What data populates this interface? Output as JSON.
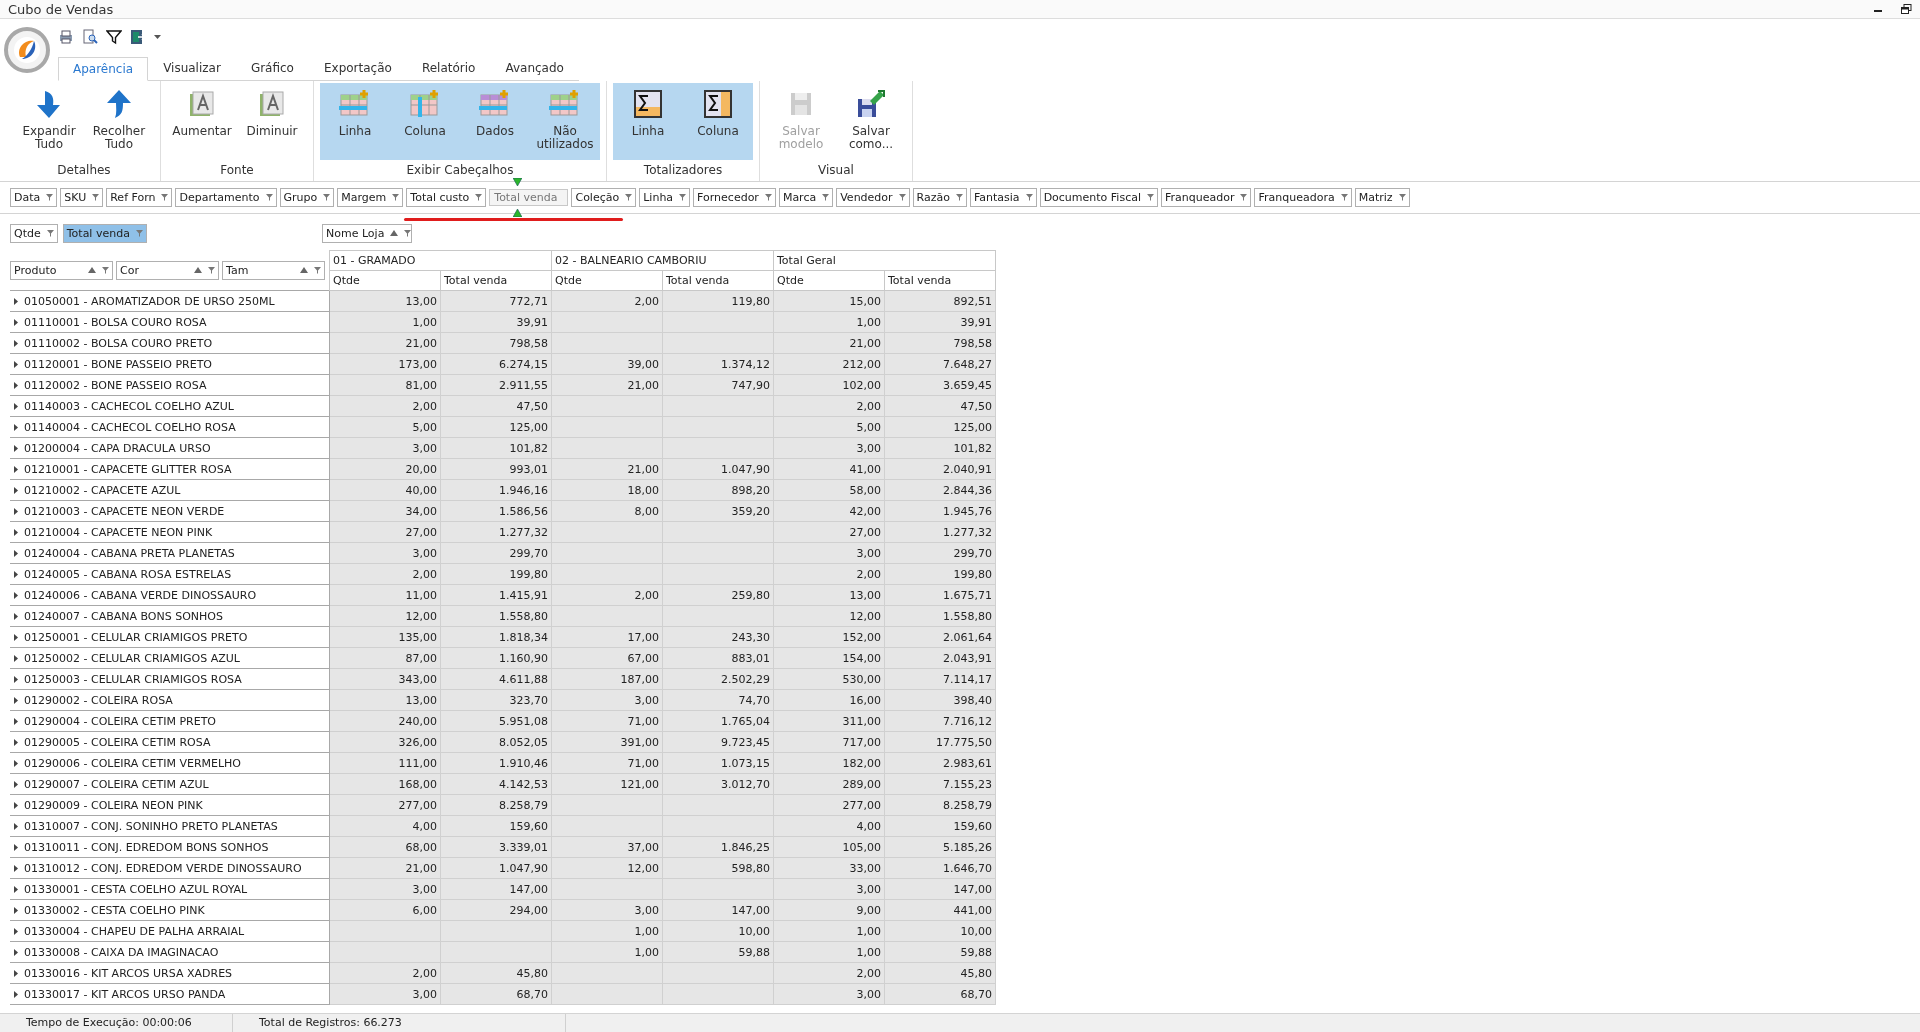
{
  "window": {
    "title": "Cubo de Vendas"
  },
  "tabs": [
    {
      "label": "Aparência",
      "selected": true
    },
    {
      "label": "Visualizar",
      "selected": false
    },
    {
      "label": "Gráfico",
      "selected": false
    },
    {
      "label": "Exportação",
      "selected": false
    },
    {
      "label": "Relatório",
      "selected": false
    },
    {
      "label": "Avançado",
      "selected": false
    }
  ],
  "ribbon": [
    {
      "label": "Detalhes",
      "buttons": [
        {
          "label": "Expandir Tudo",
          "kind": "expand",
          "pressed": false,
          "disabled": false
        },
        {
          "label": "Recolher Tudo",
          "kind": "collapse",
          "pressed": false,
          "disabled": false
        }
      ]
    },
    {
      "label": "Fonte",
      "buttons": [
        {
          "label": "Aumentar",
          "kind": "fontup",
          "pressed": false,
          "disabled": false
        },
        {
          "label": "Diminuir",
          "kind": "fontdown",
          "pressed": false,
          "disabled": false
        }
      ]
    },
    {
      "label": "Exibir Cabeçalhos",
      "buttons": [
        {
          "label": "Linha",
          "kind": "rowheader",
          "pressed": true,
          "disabled": false
        },
        {
          "label": "Coluna",
          "kind": "colheader",
          "pressed": true,
          "disabled": false
        },
        {
          "label": "Dados",
          "kind": "dataheader",
          "pressed": true,
          "disabled": false
        },
        {
          "label": "Não utilizados",
          "kind": "unusedheader",
          "pressed": true,
          "disabled": false
        }
      ]
    },
    {
      "label": "Totalizadores",
      "buttons": [
        {
          "label": "Linha",
          "kind": "sumrow",
          "pressed": true,
          "disabled": false
        },
        {
          "label": "Coluna",
          "kind": "sumcol",
          "pressed": true,
          "disabled": false
        }
      ]
    },
    {
      "label": "Visual",
      "buttons": [
        {
          "label": "Salvar modelo",
          "kind": "save",
          "pressed": false,
          "disabled": true
        },
        {
          "label": "Salvar como...",
          "kind": "saveas",
          "pressed": false,
          "disabled": false
        }
      ]
    }
  ],
  "filter_fields": [
    {
      "label": "Data",
      "kind": "field"
    },
    {
      "label": "SKU",
      "kind": "field"
    },
    {
      "label": "Ref Forn",
      "kind": "field"
    },
    {
      "label": "Departamento",
      "kind": "field"
    },
    {
      "label": "Grupo",
      "kind": "field"
    },
    {
      "label": "Margem",
      "kind": "field"
    },
    {
      "label": "Total custo",
      "kind": "field"
    },
    {
      "label": "Total venda",
      "kind": "drag_ghost"
    },
    {
      "label": "Coleção",
      "kind": "field"
    },
    {
      "label": "Linha",
      "kind": "field"
    },
    {
      "label": "Fornecedor",
      "kind": "field"
    },
    {
      "label": "Marca",
      "kind": "field"
    },
    {
      "label": "Vendedor",
      "kind": "field"
    },
    {
      "label": "Razão",
      "kind": "field"
    },
    {
      "label": "Fantasia",
      "kind": "field"
    },
    {
      "label": "Documento Fiscal",
      "kind": "field"
    },
    {
      "label": "Franqueador",
      "kind": "field"
    },
    {
      "label": "Franqueadora",
      "kind": "field"
    },
    {
      "label": "Matriz",
      "kind": "field"
    }
  ],
  "data_fields": [
    {
      "label": "Qtde",
      "selected": false
    },
    {
      "label": "Total venda",
      "selected": true
    }
  ],
  "column_field": {
    "label": "Nome Loja"
  },
  "row_fields": [
    {
      "label": "Produto"
    },
    {
      "label": "Cor"
    },
    {
      "label": "Tam"
    }
  ],
  "column_groups": [
    {
      "name": "01 - GRAMADO",
      "measures": [
        "Qtde",
        "Total venda"
      ]
    },
    {
      "name": "02 - BALNEARIO CAMBORIU",
      "measures": [
        "Qtde",
        "Total venda"
      ]
    },
    {
      "name": "Total Geral",
      "measures": [
        "Qtde",
        "Total venda"
      ]
    }
  ],
  "rows": [
    {
      "product": "01050001 - AROMATIZADOR DE URSO 250ML",
      "cells": [
        "13,00",
        "772,71",
        "2,00",
        "119,80",
        "15,00",
        "892,51"
      ]
    },
    {
      "product": "01110001 - BOLSA COURO ROSA",
      "cells": [
        "1,00",
        "39,91",
        null,
        null,
        "1,00",
        "39,91"
      ]
    },
    {
      "product": "01110002 - BOLSA COURO PRETO",
      "cells": [
        "21,00",
        "798,58",
        null,
        null,
        "21,00",
        "798,58"
      ]
    },
    {
      "product": "01120001 - BONE PASSEIO PRETO",
      "cells": [
        "173,00",
        "6.274,15",
        "39,00",
        "1.374,12",
        "212,00",
        "7.648,27"
      ]
    },
    {
      "product": "01120002 - BONE PASSEIO ROSA",
      "cells": [
        "81,00",
        "2.911,55",
        "21,00",
        "747,90",
        "102,00",
        "3.659,45"
      ]
    },
    {
      "product": "01140003 - CACHECOL COELHO AZUL",
      "cells": [
        "2,00",
        "47,50",
        null,
        null,
        "2,00",
        "47,50"
      ]
    },
    {
      "product": "01140004 - CACHECOL COELHO ROSA",
      "cells": [
        "5,00",
        "125,00",
        null,
        null,
        "5,00",
        "125,00"
      ]
    },
    {
      "product": "01200004 - CAPA DRACULA URSO",
      "cells": [
        "3,00",
        "101,82",
        null,
        null,
        "3,00",
        "101,82"
      ]
    },
    {
      "product": "01210001 - CAPACETE GLITTER ROSA",
      "cells": [
        "20,00",
        "993,01",
        "21,00",
        "1.047,90",
        "41,00",
        "2.040,91"
      ]
    },
    {
      "product": "01210002 - CAPACETE AZUL",
      "cells": [
        "40,00",
        "1.946,16",
        "18,00",
        "898,20",
        "58,00",
        "2.844,36"
      ]
    },
    {
      "product": "01210003 - CAPACETE NEON VERDE",
      "cells": [
        "34,00",
        "1.586,56",
        "8,00",
        "359,20",
        "42,00",
        "1.945,76"
      ]
    },
    {
      "product": "01210004 - CAPACETE NEON PINK",
      "cells": [
        "27,00",
        "1.277,32",
        null,
        null,
        "27,00",
        "1.277,32"
      ]
    },
    {
      "product": "01240004 - CABANA PRETA PLANETAS",
      "cells": [
        "3,00",
        "299,70",
        null,
        null,
        "3,00",
        "299,70"
      ]
    },
    {
      "product": "01240005 - CABANA ROSA ESTRELAS",
      "cells": [
        "2,00",
        "199,80",
        null,
        null,
        "2,00",
        "199,80"
      ]
    },
    {
      "product": "01240006 - CABANA VERDE DINOSSAURO",
      "cells": [
        "11,00",
        "1.415,91",
        "2,00",
        "259,80",
        "13,00",
        "1.675,71"
      ]
    },
    {
      "product": "01240007 - CABANA BONS SONHOS",
      "cells": [
        "12,00",
        "1.558,80",
        null,
        null,
        "12,00",
        "1.558,80"
      ]
    },
    {
      "product": "01250001 - CELULAR CRIAMIGOS PRETO",
      "cells": [
        "135,00",
        "1.818,34",
        "17,00",
        "243,30",
        "152,00",
        "2.061,64"
      ]
    },
    {
      "product": "01250002 - CELULAR CRIAMIGOS AZUL",
      "cells": [
        "87,00",
        "1.160,90",
        "67,00",
        "883,01",
        "154,00",
        "2.043,91"
      ]
    },
    {
      "product": "01250003 - CELULAR CRIAMIGOS ROSA",
      "cells": [
        "343,00",
        "4.611,88",
        "187,00",
        "2.502,29",
        "530,00",
        "7.114,17"
      ]
    },
    {
      "product": "01290002 - COLEIRA ROSA",
      "cells": [
        "13,00",
        "323,70",
        "3,00",
        "74,70",
        "16,00",
        "398,40"
      ]
    },
    {
      "product": "01290004 - COLEIRA CETIM PRETO",
      "cells": [
        "240,00",
        "5.951,08",
        "71,00",
        "1.765,04",
        "311,00",
        "7.716,12"
      ]
    },
    {
      "product": "01290005 - COLEIRA CETIM ROSA",
      "cells": [
        "326,00",
        "8.052,05",
        "391,00",
        "9.723,45",
        "717,00",
        "17.775,50"
      ]
    },
    {
      "product": "01290006 - COLEIRA CETIM VERMELHO",
      "cells": [
        "111,00",
        "1.910,46",
        "71,00",
        "1.073,15",
        "182,00",
        "2.983,61"
      ]
    },
    {
      "product": "01290007 - COLEIRA CETIM AZUL",
      "cells": [
        "168,00",
        "4.142,53",
        "121,00",
        "3.012,70",
        "289,00",
        "7.155,23"
      ]
    },
    {
      "product": "01290009 - COLEIRA NEON PINK",
      "cells": [
        "277,00",
        "8.258,79",
        null,
        null,
        "277,00",
        "8.258,79"
      ]
    },
    {
      "product": "01310007 - CONJ. SONINHO PRETO PLANETAS",
      "cells": [
        "4,00",
        "159,60",
        null,
        null,
        "4,00",
        "159,60"
      ]
    },
    {
      "product": "01310011 - CONJ. EDREDOM BONS SONHOS",
      "cells": [
        "68,00",
        "3.339,01",
        "37,00",
        "1.846,25",
        "105,00",
        "5.185,26"
      ]
    },
    {
      "product": "01310012 - CONJ. EDREDOM VERDE DINOSSAURO",
      "cells": [
        "21,00",
        "1.047,90",
        "12,00",
        "598,80",
        "33,00",
        "1.646,70"
      ]
    },
    {
      "product": "01330001 - CESTA COELHO AZUL ROYAL",
      "cells": [
        "3,00",
        "147,00",
        null,
        null,
        "3,00",
        "147,00"
      ]
    },
    {
      "product": "01330002 - CESTA COELHO PINK",
      "cells": [
        "6,00",
        "294,00",
        "3,00",
        "147,00",
        "9,00",
        "441,00"
      ]
    },
    {
      "product": "01330004 - CHAPEU DE PALHA ARRAIAL",
      "cells": [
        null,
        null,
        "1,00",
        "10,00",
        "1,00",
        "10,00"
      ]
    },
    {
      "product": "01330008 - CAIXA DA IMAGINACAO",
      "cells": [
        null,
        null,
        "1,00",
        "59,88",
        "1,00",
        "59,88"
      ]
    },
    {
      "product": "01330016 - KIT ARCOS URSA XADRES",
      "cells": [
        "2,00",
        "45,80",
        null,
        null,
        "2,00",
        "45,80"
      ]
    },
    {
      "product": "01330017 - KIT ARCOS URSO PANDA",
      "cells": [
        "3,00",
        "68,70",
        null,
        null,
        "3,00",
        "68,70"
      ]
    }
  ],
  "status_bar": [
    "Tempo de Execução: 00:00:06",
    "Total de Registros: 66.273"
  ]
}
